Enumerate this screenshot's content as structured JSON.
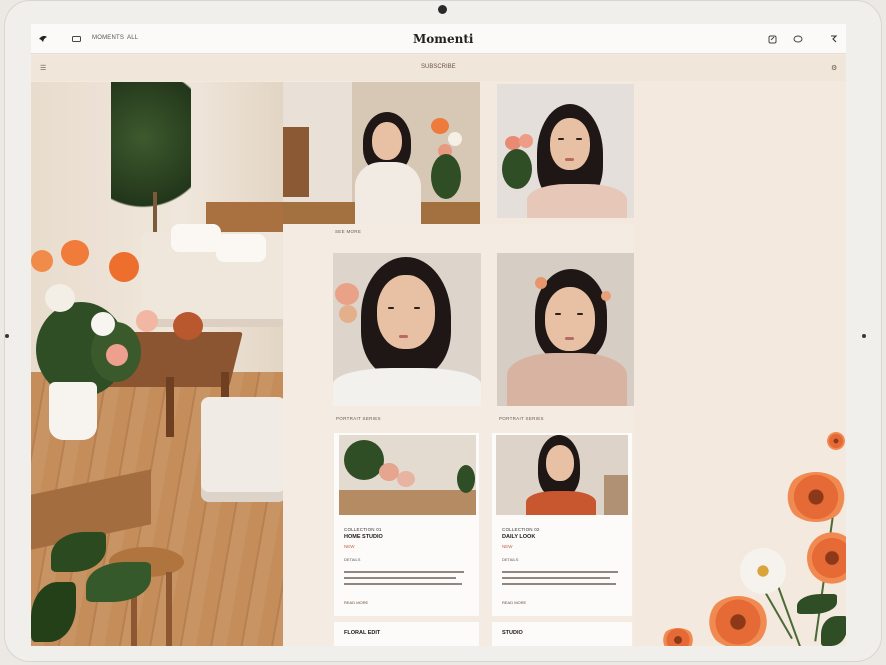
{
  "topbar": {
    "left_icon": "logo-icon",
    "message_icon": "message-icon",
    "nav_label": "MOMENTS",
    "nav_label2": "ALL",
    "brand": "Momenti",
    "right_icons": [
      "share-icon",
      "heart-icon",
      "profile-icon"
    ]
  },
  "subbar": {
    "left": "☰",
    "center": "SUBSCRIBE",
    "right": "⚙"
  },
  "labels": {
    "section1": "SEE MORE",
    "caption1": "PORTRAIT SERIES",
    "caption2": "PORTRAIT SERIES"
  },
  "cards": [
    {
      "meta": "COLLECTION 01",
      "title": "HOME STUDIO",
      "accent": "NEW",
      "small": "DETAILS",
      "link": "READ MORE"
    },
    {
      "meta": "COLLECTION 02",
      "title": "DAILY LOOK",
      "accent": "NEW",
      "small": "DETAILS",
      "link": "READ MORE"
    }
  ],
  "cards_bottom": [
    "FLORAL EDIT",
    "STUDIO"
  ],
  "colors": {
    "accent": "#c2653e",
    "background": "#f3e9df",
    "panel": "#f4ebe2"
  }
}
